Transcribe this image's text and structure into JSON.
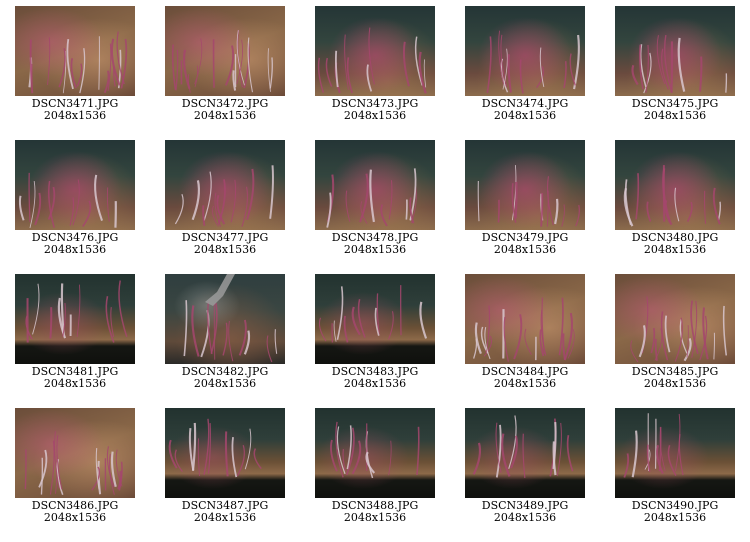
{
  "gallery": {
    "items": [
      {
        "filename": "DSCN3471.JPG",
        "dimensions": "2048x1536",
        "style": "v-close"
      },
      {
        "filename": "DSCN3472.JPG",
        "dimensions": "2048x1536",
        "style": "v-close"
      },
      {
        "filename": "DSCN3473.JPG",
        "dimensions": "2048x1536",
        "style": "v-tall"
      },
      {
        "filename": "DSCN3474.JPG",
        "dimensions": "2048x1536",
        "style": "v-tall"
      },
      {
        "filename": "DSCN3475.JPG",
        "dimensions": "2048x1536",
        "style": "v-tall"
      },
      {
        "filename": "DSCN3476.JPG",
        "dimensions": "2048x1536",
        "style": "v-tall"
      },
      {
        "filename": "DSCN3477.JPG",
        "dimensions": "2048x1536",
        "style": "v-tall"
      },
      {
        "filename": "DSCN3478.JPG",
        "dimensions": "2048x1536",
        "style": "v-tall"
      },
      {
        "filename": "DSCN3479.JPG",
        "dimensions": "2048x1536",
        "style": "v-tall"
      },
      {
        "filename": "DSCN3480.JPG",
        "dimensions": "2048x1536",
        "style": "v-tall"
      },
      {
        "filename": "DSCN3481.JPG",
        "dimensions": "2048x1536",
        "style": "v-log"
      },
      {
        "filename": "DSCN3482.JPG",
        "dimensions": "2048x1536",
        "style": "v-claw"
      },
      {
        "filename": "DSCN3483.JPG",
        "dimensions": "2048x1536",
        "style": "v-log"
      },
      {
        "filename": "DSCN3484.JPG",
        "dimensions": "2048x1536",
        "style": "v-close"
      },
      {
        "filename": "DSCN3485.JPG",
        "dimensions": "2048x1536",
        "style": "v-close"
      },
      {
        "filename": "DSCN3486.JPG",
        "dimensions": "2048x1536",
        "style": "v-close"
      },
      {
        "filename": "DSCN3487.JPG",
        "dimensions": "2048x1536",
        "style": "v-log"
      },
      {
        "filename": "DSCN3488.JPG",
        "dimensions": "2048x1536",
        "style": "v-log"
      },
      {
        "filename": "DSCN3489.JPG",
        "dimensions": "2048x1536",
        "style": "v-log"
      },
      {
        "filename": "DSCN3490.JPG",
        "dimensions": "2048x1536",
        "style": "v-log"
      }
    ]
  }
}
